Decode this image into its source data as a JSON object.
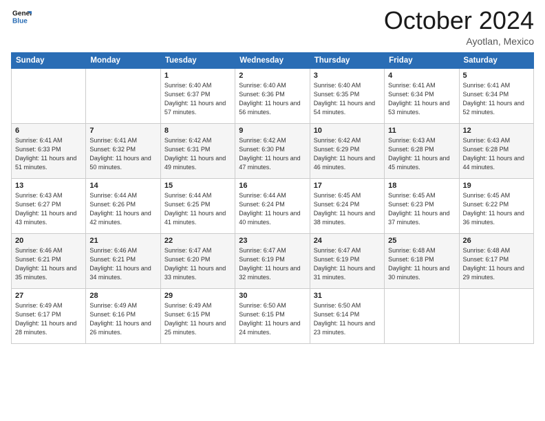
{
  "header": {
    "logo_line1": "General",
    "logo_line2": "Blue",
    "month": "October 2024",
    "location": "Ayotlan, Mexico"
  },
  "weekdays": [
    "Sunday",
    "Monday",
    "Tuesday",
    "Wednesday",
    "Thursday",
    "Friday",
    "Saturday"
  ],
  "weeks": [
    [
      {
        "day": "",
        "info": ""
      },
      {
        "day": "",
        "info": ""
      },
      {
        "day": "1",
        "info": "Sunrise: 6:40 AM\nSunset: 6:37 PM\nDaylight: 11 hours and 57 minutes."
      },
      {
        "day": "2",
        "info": "Sunrise: 6:40 AM\nSunset: 6:36 PM\nDaylight: 11 hours and 56 minutes."
      },
      {
        "day": "3",
        "info": "Sunrise: 6:40 AM\nSunset: 6:35 PM\nDaylight: 11 hours and 54 minutes."
      },
      {
        "day": "4",
        "info": "Sunrise: 6:41 AM\nSunset: 6:34 PM\nDaylight: 11 hours and 53 minutes."
      },
      {
        "day": "5",
        "info": "Sunrise: 6:41 AM\nSunset: 6:34 PM\nDaylight: 11 hours and 52 minutes."
      }
    ],
    [
      {
        "day": "6",
        "info": "Sunrise: 6:41 AM\nSunset: 6:33 PM\nDaylight: 11 hours and 51 minutes."
      },
      {
        "day": "7",
        "info": "Sunrise: 6:41 AM\nSunset: 6:32 PM\nDaylight: 11 hours and 50 minutes."
      },
      {
        "day": "8",
        "info": "Sunrise: 6:42 AM\nSunset: 6:31 PM\nDaylight: 11 hours and 49 minutes."
      },
      {
        "day": "9",
        "info": "Sunrise: 6:42 AM\nSunset: 6:30 PM\nDaylight: 11 hours and 47 minutes."
      },
      {
        "day": "10",
        "info": "Sunrise: 6:42 AM\nSunset: 6:29 PM\nDaylight: 11 hours and 46 minutes."
      },
      {
        "day": "11",
        "info": "Sunrise: 6:43 AM\nSunset: 6:28 PM\nDaylight: 11 hours and 45 minutes."
      },
      {
        "day": "12",
        "info": "Sunrise: 6:43 AM\nSunset: 6:28 PM\nDaylight: 11 hours and 44 minutes."
      }
    ],
    [
      {
        "day": "13",
        "info": "Sunrise: 6:43 AM\nSunset: 6:27 PM\nDaylight: 11 hours and 43 minutes."
      },
      {
        "day": "14",
        "info": "Sunrise: 6:44 AM\nSunset: 6:26 PM\nDaylight: 11 hours and 42 minutes."
      },
      {
        "day": "15",
        "info": "Sunrise: 6:44 AM\nSunset: 6:25 PM\nDaylight: 11 hours and 41 minutes."
      },
      {
        "day": "16",
        "info": "Sunrise: 6:44 AM\nSunset: 6:24 PM\nDaylight: 11 hours and 40 minutes."
      },
      {
        "day": "17",
        "info": "Sunrise: 6:45 AM\nSunset: 6:24 PM\nDaylight: 11 hours and 38 minutes."
      },
      {
        "day": "18",
        "info": "Sunrise: 6:45 AM\nSunset: 6:23 PM\nDaylight: 11 hours and 37 minutes."
      },
      {
        "day": "19",
        "info": "Sunrise: 6:45 AM\nSunset: 6:22 PM\nDaylight: 11 hours and 36 minutes."
      }
    ],
    [
      {
        "day": "20",
        "info": "Sunrise: 6:46 AM\nSunset: 6:21 PM\nDaylight: 11 hours and 35 minutes."
      },
      {
        "day": "21",
        "info": "Sunrise: 6:46 AM\nSunset: 6:21 PM\nDaylight: 11 hours and 34 minutes."
      },
      {
        "day": "22",
        "info": "Sunrise: 6:47 AM\nSunset: 6:20 PM\nDaylight: 11 hours and 33 minutes."
      },
      {
        "day": "23",
        "info": "Sunrise: 6:47 AM\nSunset: 6:19 PM\nDaylight: 11 hours and 32 minutes."
      },
      {
        "day": "24",
        "info": "Sunrise: 6:47 AM\nSunset: 6:19 PM\nDaylight: 11 hours and 31 minutes."
      },
      {
        "day": "25",
        "info": "Sunrise: 6:48 AM\nSunset: 6:18 PM\nDaylight: 11 hours and 30 minutes."
      },
      {
        "day": "26",
        "info": "Sunrise: 6:48 AM\nSunset: 6:17 PM\nDaylight: 11 hours and 29 minutes."
      }
    ],
    [
      {
        "day": "27",
        "info": "Sunrise: 6:49 AM\nSunset: 6:17 PM\nDaylight: 11 hours and 28 minutes."
      },
      {
        "day": "28",
        "info": "Sunrise: 6:49 AM\nSunset: 6:16 PM\nDaylight: 11 hours and 26 minutes."
      },
      {
        "day": "29",
        "info": "Sunrise: 6:49 AM\nSunset: 6:15 PM\nDaylight: 11 hours and 25 minutes."
      },
      {
        "day": "30",
        "info": "Sunrise: 6:50 AM\nSunset: 6:15 PM\nDaylight: 11 hours and 24 minutes."
      },
      {
        "day": "31",
        "info": "Sunrise: 6:50 AM\nSunset: 6:14 PM\nDaylight: 11 hours and 23 minutes."
      },
      {
        "day": "",
        "info": ""
      },
      {
        "day": "",
        "info": ""
      }
    ]
  ]
}
